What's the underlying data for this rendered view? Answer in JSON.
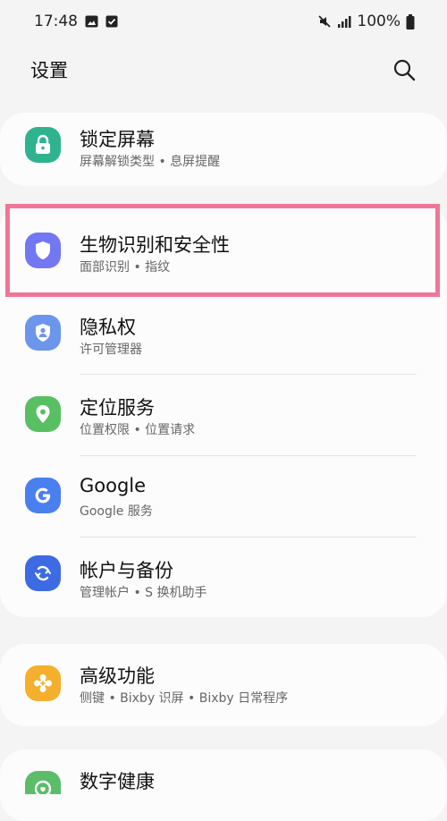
{
  "status_bar": {
    "time": "17:48",
    "battery": "100%"
  },
  "header": {
    "title": "设置",
    "search_icon": "search-icon"
  },
  "colors": {
    "background": "#f4f4f4",
    "card": "#fcfcfc",
    "highlight": "#f07697",
    "lock": "#2fb38f",
    "biometrics": "#7477f2",
    "privacy": "#6c95ec",
    "location": "#58bf63",
    "google": "#4a7ff0",
    "accounts": "#3d6be3",
    "advanced": "#f4b02d",
    "wellbeing": "#5bbd6a"
  },
  "items": [
    {
      "title": "锁定屏幕",
      "subtitle": "屏幕解锁类型 • 息屏提醒",
      "icon": "lock-icon"
    },
    {
      "title": "生物识别和安全性",
      "subtitle": "面部识别 • 指纹",
      "icon": "shield-icon"
    },
    {
      "title": "隐私权",
      "subtitle": "许可管理器",
      "icon": "privacy-icon"
    },
    {
      "title": "定位服务",
      "subtitle": "位置权限 • 位置请求",
      "icon": "location-pin-icon"
    },
    {
      "title": "Google",
      "subtitle": "Google 服务",
      "icon": "google-icon"
    },
    {
      "title": "帐户与备份",
      "subtitle": "管理帐户 • S 换机助手",
      "icon": "sync-icon"
    },
    {
      "title": "高级功能",
      "subtitle": "侧键 • Bixby 识屏 • Bixby 日常程序",
      "icon": "advanced-features-icon"
    },
    {
      "title": "数字健康",
      "subtitle": "",
      "icon": "wellbeing-icon"
    }
  ]
}
